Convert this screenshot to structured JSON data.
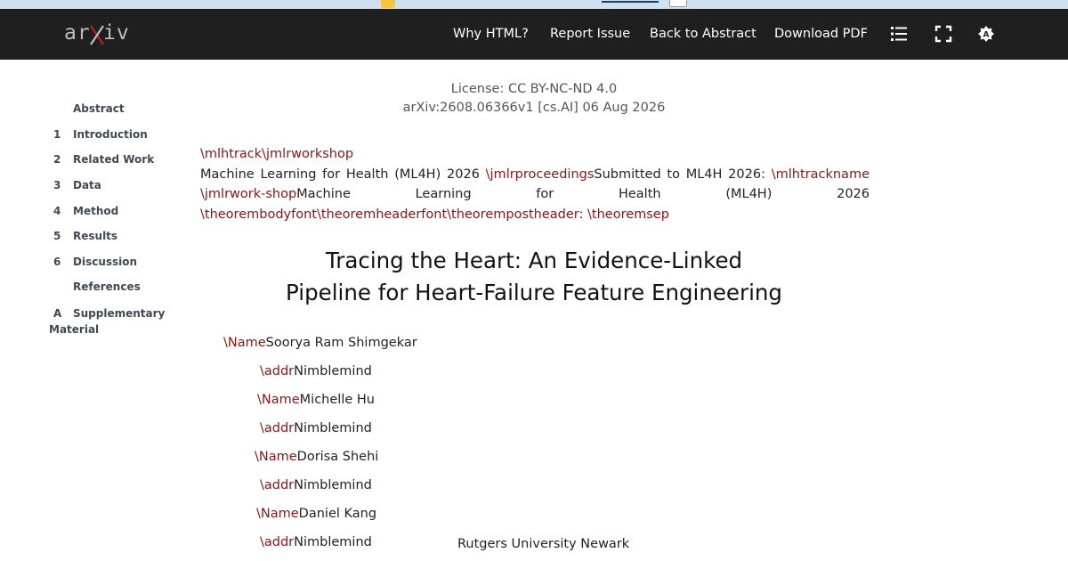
{
  "header": {
    "logo_text": "arXiv",
    "nav": [
      "Why HTML?",
      "Report Issue",
      "Back to Abstract",
      "Download PDF"
    ],
    "icons": [
      "list-icon",
      "fullscreen-icon",
      "theme-icon"
    ],
    "colors": {
      "bar": "#1f1f1f",
      "logo_x": "#b31b1b",
      "nav_text": "#ffffff"
    }
  },
  "toc": {
    "items": [
      {
        "num": "",
        "label": "Abstract"
      },
      {
        "num": "1",
        "label": "Introduction"
      },
      {
        "num": "2",
        "label": "Related Work"
      },
      {
        "num": "3",
        "label": "Data"
      },
      {
        "num": "4",
        "label": "Method"
      },
      {
        "num": "5",
        "label": "Results"
      },
      {
        "num": "6",
        "label": "Discussion"
      },
      {
        "num": "",
        "label": "References"
      },
      {
        "num": "A",
        "label": "Supplementary Material"
      }
    ]
  },
  "meta": {
    "license": "License: CC BY-NC-ND 4.0",
    "arxiv_id": "arXiv:2608.06366v1 [cs.AI] 06 Aug 2026"
  },
  "front_matter": {
    "line1": "\\mlhtrack\\jmlrworkshop",
    "venue1": "Machine Learning for Health (ML4H) 2026 ",
    "proc_macro": "\\jmlrproceedings",
    "submitted": "Submitted to ML4H 2026: ",
    "trackname_macro": "\\mlhtrackname \\jmlrwork-shop",
    "venue2": "Machine Learning for Health (ML4H) 2026 ",
    "theorem_macros": "\\theorembodyfont\\theoremheaderfont\\theorempostheader",
    "colon": ": ",
    "sep_macro": "\\theoremsep"
  },
  "title": {
    "line1": "Tracing the Heart: An Evidence-Linked",
    "line2": "Pipeline for Heart-Failure Feature Engineering"
  },
  "authors": [
    {
      "macro": "\\Name",
      "text": "Soorya Ram Shimgekar"
    },
    {
      "macro": "\\addr",
      "text": "Nimblemind"
    },
    {
      "macro": "\\Name",
      "text": "Michelle Hu"
    },
    {
      "macro": "\\addr",
      "text": "Nimblemind"
    },
    {
      "macro": "\\Name",
      "text": "Dorisa Shehi"
    },
    {
      "macro": "\\addr",
      "text": "Nimblemind"
    },
    {
      "macro": "\\Name",
      "text": "Daniel Kang"
    },
    {
      "macro": "\\addr",
      "text": "Nimblemind"
    }
  ],
  "affiliation": "Rutgers University Newark"
}
